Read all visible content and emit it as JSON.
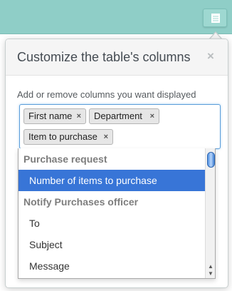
{
  "toolbar": {
    "columns_button_icon": "columns-icon"
  },
  "dialog": {
    "title": "Customize the table's columns",
    "close_label": "×",
    "helper_text": "Add or remove columns you want displayed"
  },
  "selected_columns": [
    {
      "label": "First name",
      "remove": "×"
    },
    {
      "label": "Department",
      "remove": "×"
    },
    {
      "label": "Item to purchase",
      "remove": "×"
    }
  ],
  "dropdown": {
    "groups": [
      {
        "label": "Purchase request",
        "options": [
          {
            "label": "Number of items to purchase",
            "highlighted": true
          }
        ]
      },
      {
        "label": "Notify Purchases officer",
        "options": [
          {
            "label": "To"
          },
          {
            "label": "Subject"
          },
          {
            "label": "Message"
          }
        ]
      }
    ],
    "scroll_up": "▲",
    "scroll_down": "▼"
  },
  "colors": {
    "top_bar": "#8fcec7",
    "highlight": "#3875d7",
    "focus_border": "#5b9dd9"
  }
}
